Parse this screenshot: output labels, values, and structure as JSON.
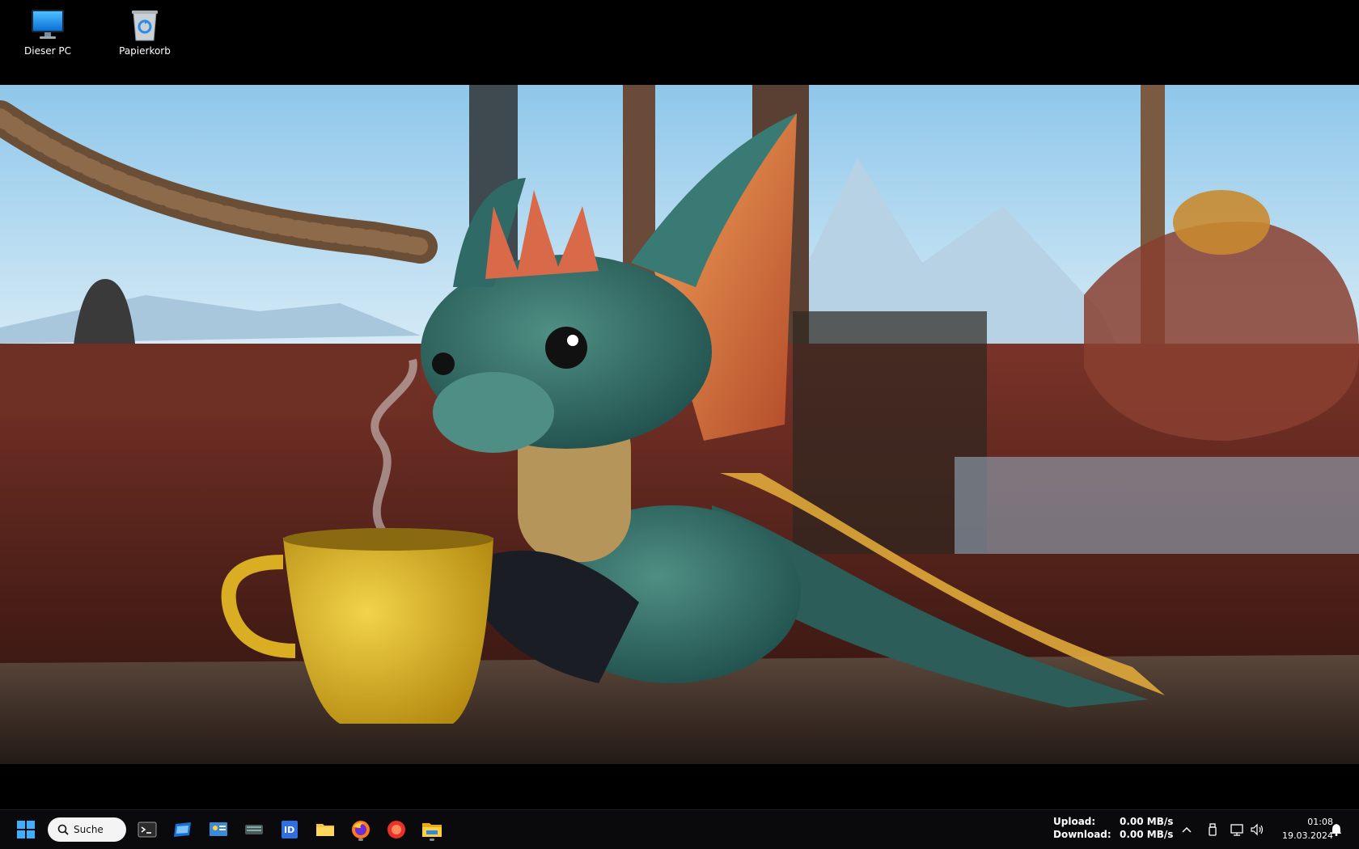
{
  "desktop": {
    "icons": [
      {
        "label": "Dieser PC",
        "icon": "monitor-icon"
      },
      {
        "label": "Papierkorb",
        "icon": "recycle-bin-icon"
      }
    ]
  },
  "wallpaper": {
    "description_icon": "dragon-wallpaper"
  },
  "taskbar": {
    "search_label": "Suche",
    "apps": [
      "start-icon",
      "terminal-icon",
      "window-icon",
      "control-panel-icon",
      "keyboard-icon",
      "id-app-icon",
      "folder-icon",
      "firefox-icon",
      "record-icon",
      "file-explorer-icon"
    ],
    "upload_label": "Upload:",
    "upload_value": "0.00 MB/s",
    "download_label": "Download:",
    "download_value": "0.00 MB/s",
    "time": "01:08",
    "date": "19.03.2024"
  },
  "colors": {
    "taskbar_bg": "#0a0a0c",
    "accent": "#0a84ff"
  }
}
